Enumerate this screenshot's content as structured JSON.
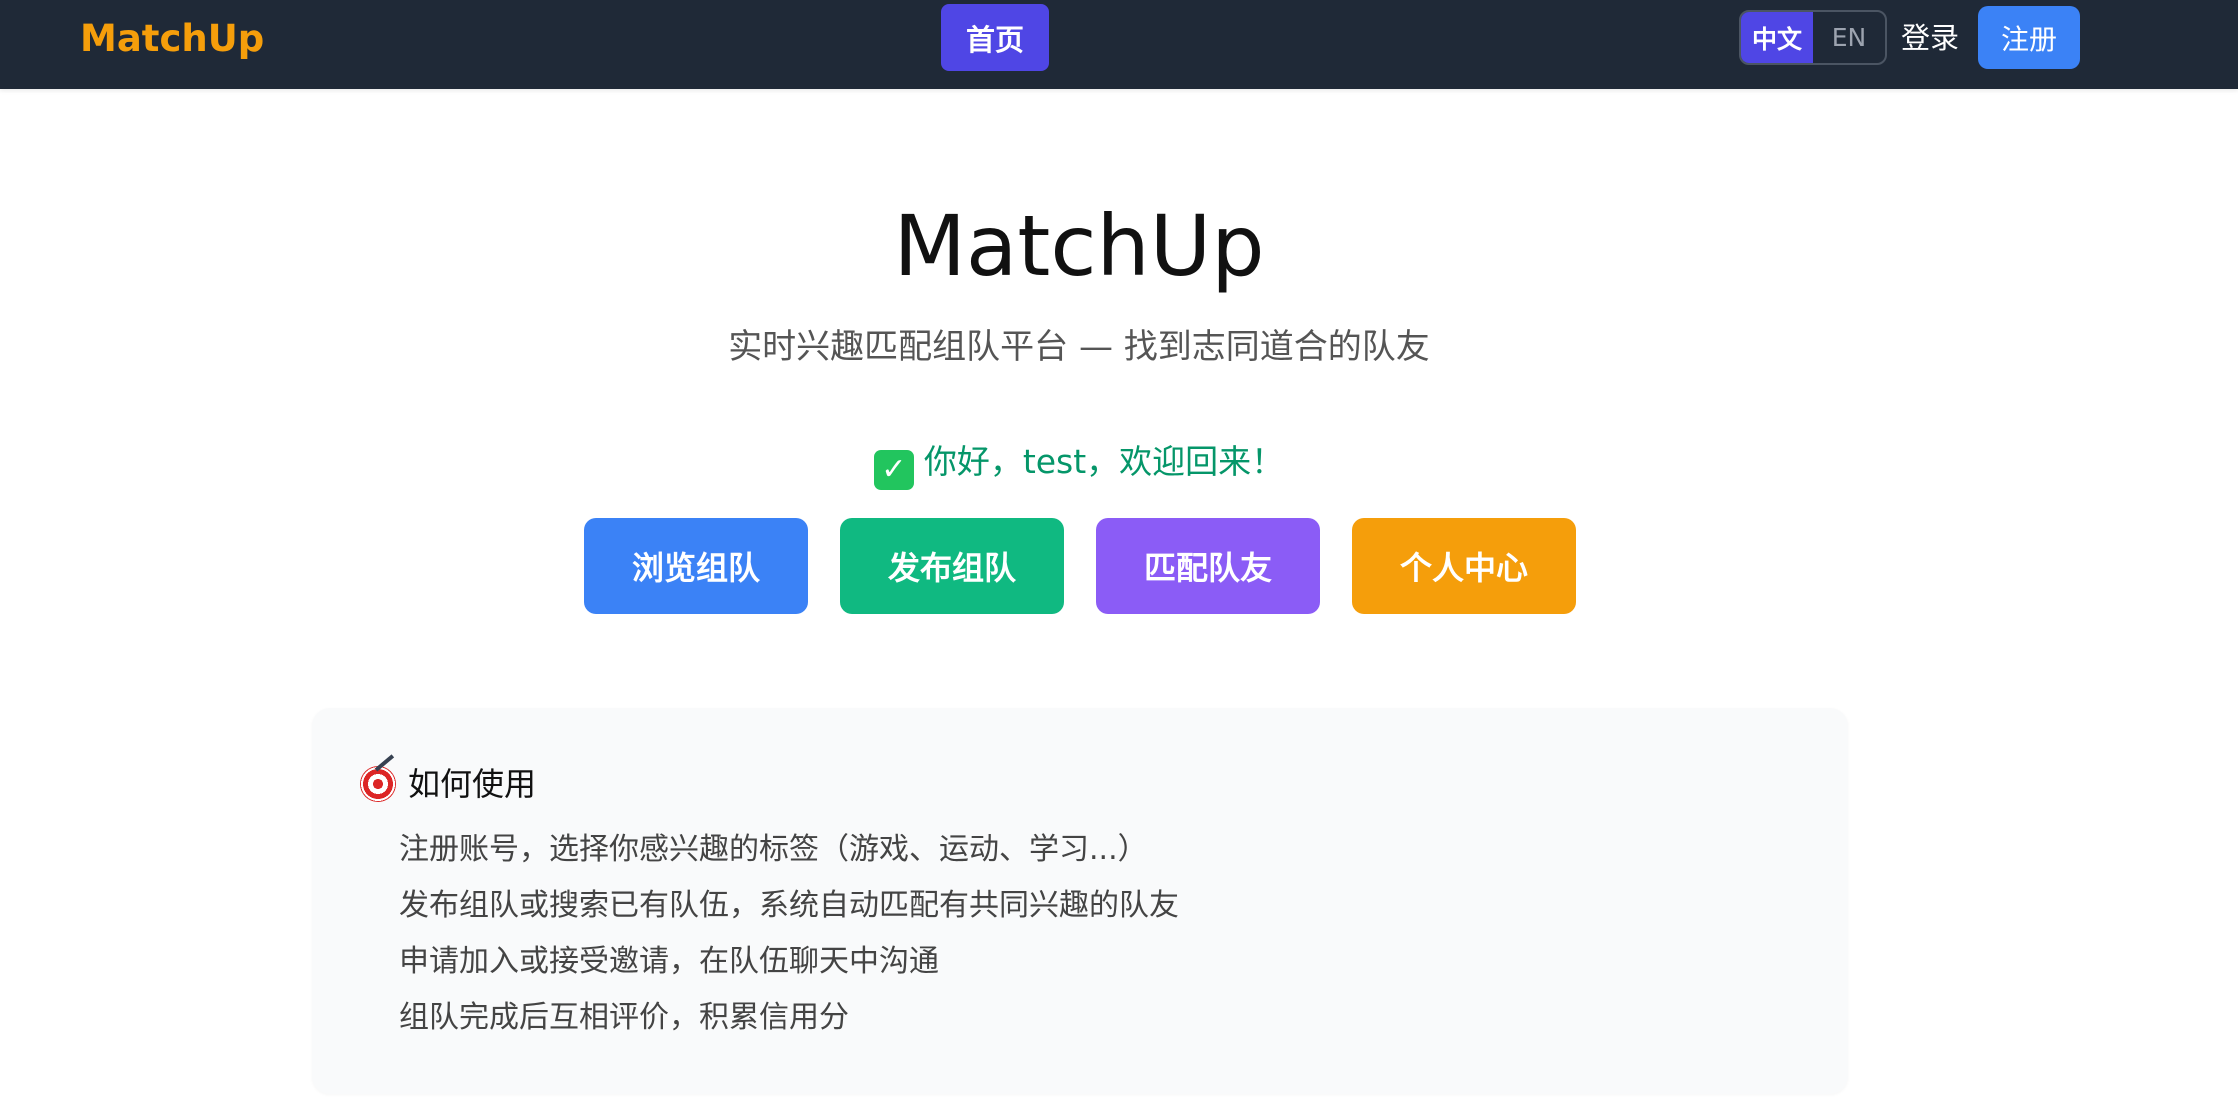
{
  "nav": {
    "brand": "MatchUp",
    "home": "首页",
    "lang": {
      "zh": "中文",
      "en": "EN"
    },
    "login": "登录",
    "register": "注册"
  },
  "hero": {
    "title": "MatchUp",
    "subtitle": "实时兴趣匹配组队平台 — 找到志同道合的队友",
    "welcome": "你好，test，欢迎回来！"
  },
  "actions": {
    "browse": "浏览组队",
    "post": "发布组队",
    "match": "匹配队友",
    "profile": "个人中心"
  },
  "howto": {
    "title": "如何使用",
    "steps": [
      "注册账号，选择你感兴趣的标签（游戏、运动、学习...）",
      "发布组队或搜索已有队伍，系统自动匹配有共同兴趣的队友",
      "申请加入或接受邀请，在队伍聊天中沟通",
      "组队完成后互相评价，积累信用分"
    ]
  },
  "colors": {
    "navbar": "#1f2937",
    "brand": "#f59e0b",
    "home": "#4f46e5",
    "register": "#3b82f6",
    "welcome": "#059669",
    "browse": "#3b82f6",
    "post": "#10b981",
    "match": "#8b5cf6",
    "profile": "#f59e0b"
  },
  "icons": {
    "welcome": "check-mark-icon",
    "howto": "target-icon"
  }
}
